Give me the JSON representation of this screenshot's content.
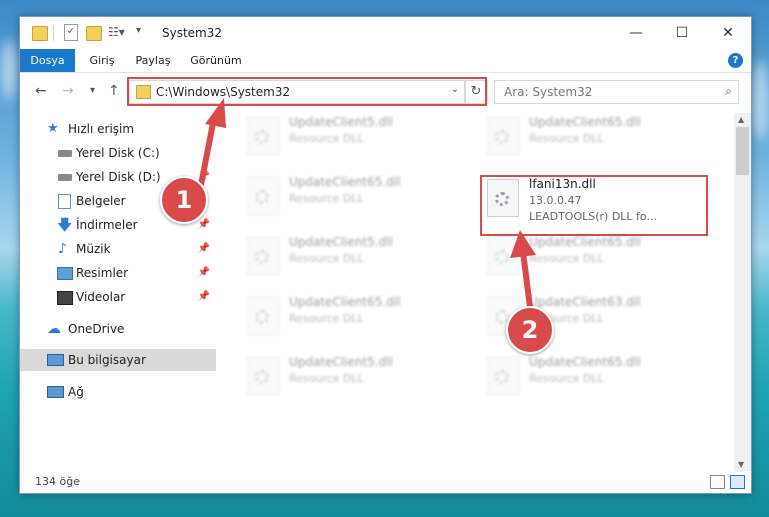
{
  "window": {
    "title": "System32",
    "controls": {
      "minimize": "—",
      "maximize": "☐",
      "close": "✕"
    }
  },
  "ribbon": {
    "tabs": [
      {
        "label": "Dosya",
        "active": true
      },
      {
        "label": "Giriş"
      },
      {
        "label": "Paylaş"
      },
      {
        "label": "Görünüm"
      }
    ],
    "help": "?"
  },
  "address": {
    "path": "C:\\Windows\\System32",
    "search_placeholder": "Ara: System32"
  },
  "sidebar": {
    "items": [
      {
        "label": "Hızlı erişim",
        "icon": "star-icon"
      },
      {
        "label": "Yerel Disk (C:)",
        "icon": "drive-icon"
      },
      {
        "label": "Yerel Disk (D:)",
        "icon": "drive-icon"
      },
      {
        "label": "Belgeler",
        "icon": "documents-icon"
      },
      {
        "label": "İndirmeler",
        "icon": "download-icon"
      },
      {
        "label": "Müzik",
        "icon": "music-icon"
      },
      {
        "label": "Resimler",
        "icon": "pictures-icon"
      },
      {
        "label": "Videolar",
        "icon": "videos-icon"
      },
      {
        "label": "OneDrive",
        "icon": "cloud-icon"
      },
      {
        "label": "Bu bilgisayar",
        "icon": "computer-icon"
      },
      {
        "label": "Ağ",
        "icon": "network-icon"
      }
    ]
  },
  "files": [
    {
      "name": "UpdateClient5.dll",
      "type": "Resource DLL"
    },
    {
      "name": "UpdateClient65.dll",
      "type": "Resource DLL"
    },
    {
      "name": "UpdateClient65.dll",
      "type": "Resource DLL"
    },
    {
      "name": "lfani13n.dll",
      "version": "13.0.0.47",
      "desc": "LEADTOOLS(r) DLL fo..."
    },
    {
      "name": "UpdateClient5.dll",
      "type": "Resource DLL"
    },
    {
      "name": "UpdateClient65.dll",
      "type": "Resource DLL"
    },
    {
      "name": "UpdateClient65.dll",
      "type": "Resource DLL"
    },
    {
      "name": "UpdateClient63.dll",
      "type": "Resource DLL"
    },
    {
      "name": "UpdateClient5.dll",
      "type": "Resource DLL"
    },
    {
      "name": "UpdateClient65.dll",
      "type": "Resource DLL"
    }
  ],
  "status": {
    "count": "134 öğe"
  },
  "annotations": {
    "step1": "1",
    "step2": "2"
  },
  "colors": {
    "accent": "#1979ca",
    "highlight": "#d94b4b"
  }
}
